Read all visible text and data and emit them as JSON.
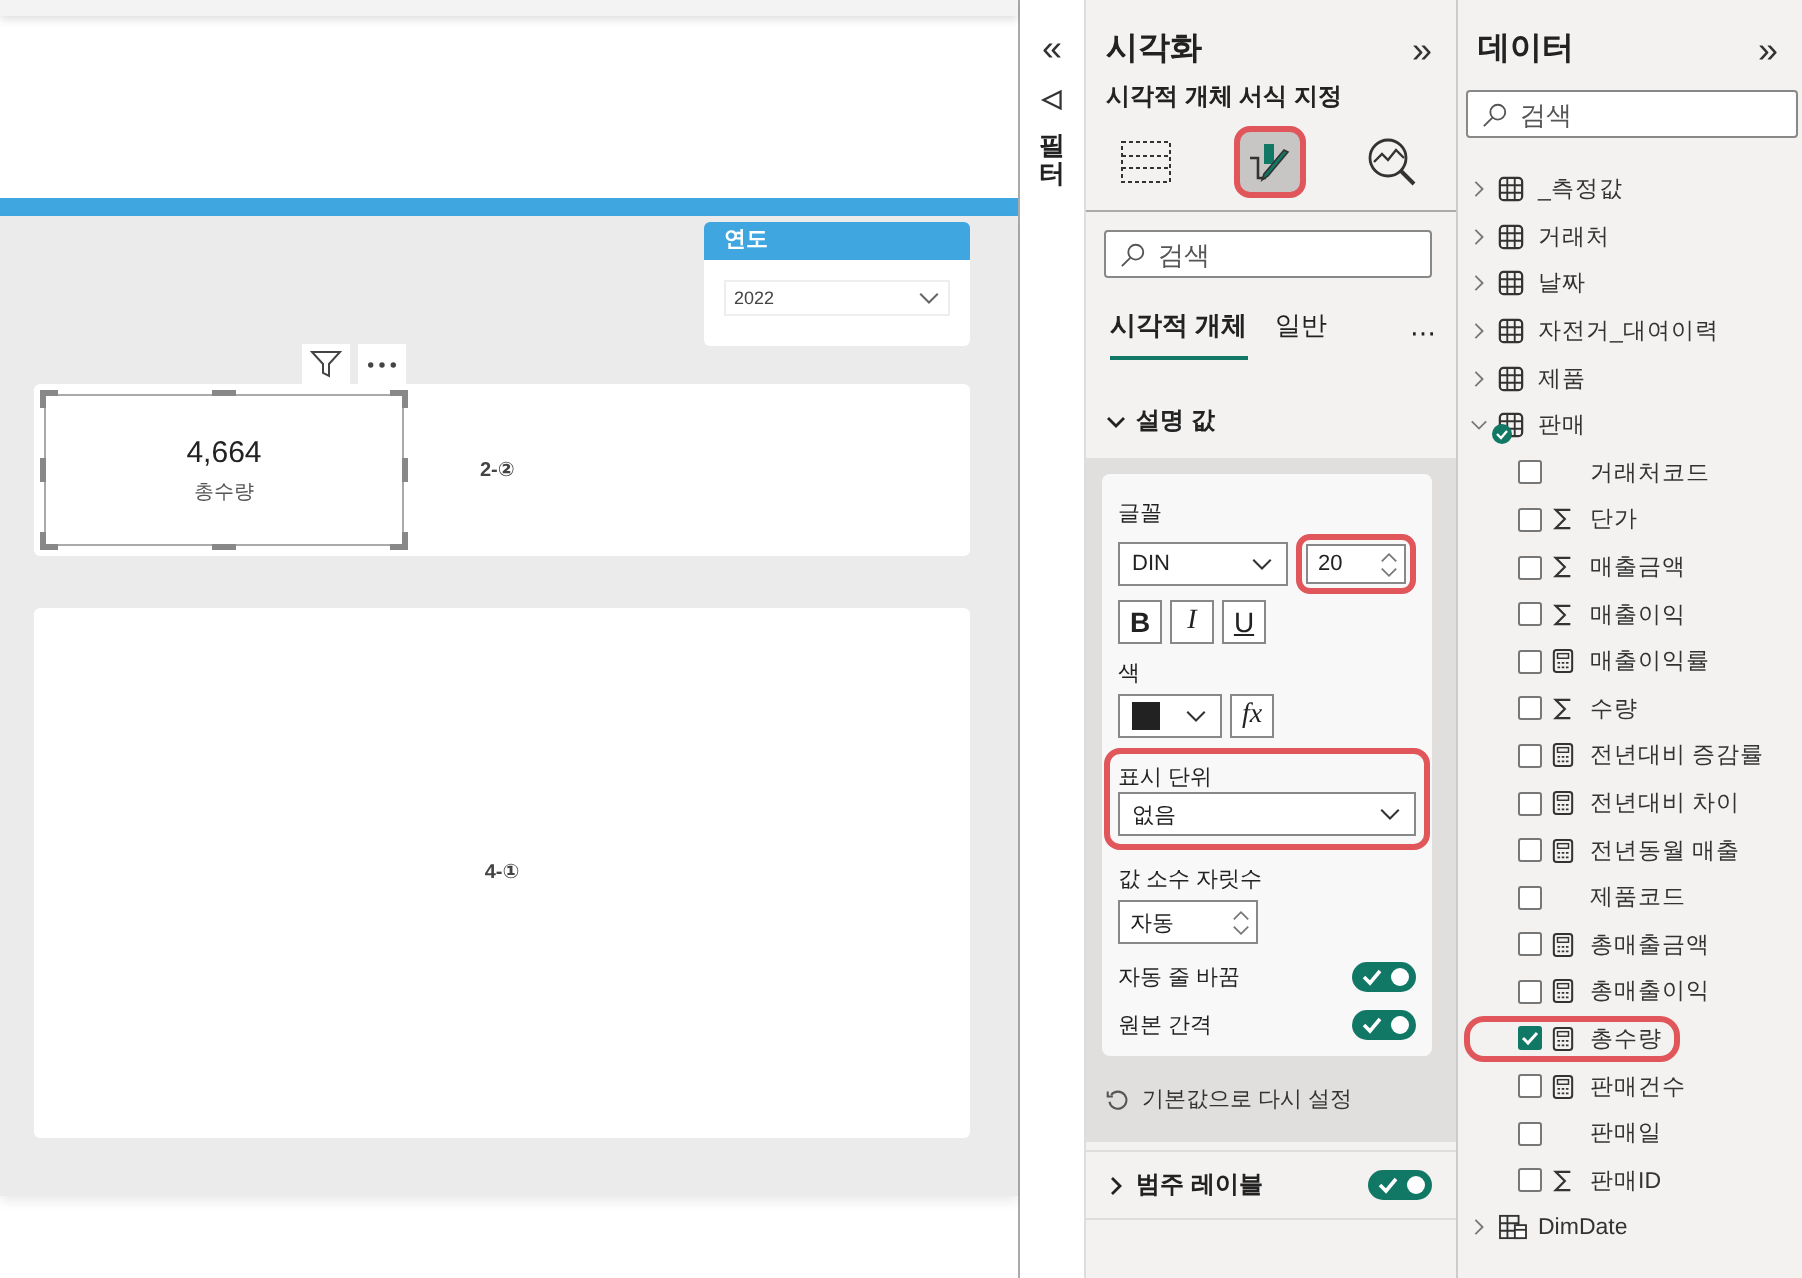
{
  "canvas": {
    "slicer": {
      "title": "연도",
      "value": "2022"
    },
    "kpi": {
      "value": "4,664",
      "label": "총수량",
      "selected": true
    },
    "placeholders": [
      {
        "text": "2-②"
      },
      {
        "text": "4-①"
      }
    ]
  },
  "filter_strip": {
    "expand": "«",
    "label": "필터"
  },
  "visualizations": {
    "title": "시각화",
    "collapse": "»",
    "subtitle": "시각적 개체 서식 지정",
    "view_buttons": [
      {
        "kind": "build",
        "selected": false,
        "highlighted": false
      },
      {
        "kind": "format",
        "selected": true,
        "highlighted": true
      },
      {
        "kind": "analytics",
        "selected": false,
        "highlighted": false
      }
    ],
    "search": {
      "placeholder": "검색"
    },
    "tabs": [
      {
        "label": "시각적 개체",
        "selected": true
      },
      {
        "label": "일반",
        "selected": false
      }
    ],
    "more": "⋯",
    "section": {
      "title": "설명 값",
      "expanded": true
    },
    "font": {
      "label": "글꼴",
      "family": "DIN",
      "size": "20",
      "size_highlighted": true,
      "bold_label": "B",
      "italic_label": "I",
      "underline_label": "U"
    },
    "color": {
      "label": "색",
      "fx_label": "fx"
    },
    "display_units": {
      "label": "표시 단위",
      "value": "없음",
      "highlighted": true
    },
    "decimals": {
      "label": "값 소수 자릿수",
      "value": "자동"
    },
    "toggles": [
      {
        "label": "자동 줄 바꿈",
        "on": true
      },
      {
        "label": "원본 간격",
        "on": true
      }
    ],
    "reset": "기본값으로 다시 설정",
    "next_section": {
      "title": "범주 레이블",
      "expanded": false,
      "on": true
    }
  },
  "data": {
    "title": "데이터",
    "collapse": "»",
    "search": {
      "placeholder": "검색"
    },
    "tables": [
      {
        "name": "_측정값",
        "kind": "table",
        "expanded": false,
        "in_use": false
      },
      {
        "name": "거래처",
        "kind": "table",
        "expanded": false,
        "in_use": false
      },
      {
        "name": "날짜",
        "kind": "table",
        "expanded": false,
        "in_use": false
      },
      {
        "name": "자전거_대여이력",
        "kind": "table",
        "expanded": false,
        "in_use": false
      },
      {
        "name": "제품",
        "kind": "table",
        "expanded": false,
        "in_use": false
      },
      {
        "name": "판매",
        "kind": "table",
        "expanded": true,
        "in_use": true,
        "fields": [
          {
            "name": "거래처코드",
            "kind": "column",
            "checked": false,
            "highlighted": false
          },
          {
            "name": "단가",
            "kind": "sum",
            "checked": false,
            "highlighted": false
          },
          {
            "name": "매출금액",
            "kind": "sum",
            "checked": false,
            "highlighted": false
          },
          {
            "name": "매출이익",
            "kind": "sum",
            "checked": false,
            "highlighted": false
          },
          {
            "name": "매출이익률",
            "kind": "measure",
            "checked": false,
            "highlighted": false
          },
          {
            "name": "수량",
            "kind": "sum",
            "checked": false,
            "highlighted": false
          },
          {
            "name": "전년대비 증감률",
            "kind": "measure",
            "checked": false,
            "highlighted": false
          },
          {
            "name": "전년대비 차이",
            "kind": "measure",
            "checked": false,
            "highlighted": false
          },
          {
            "name": "전년동월 매출",
            "kind": "measure",
            "checked": false,
            "highlighted": false
          },
          {
            "name": "제품코드",
            "kind": "column",
            "checked": false,
            "highlighted": false
          },
          {
            "name": "총매출금액",
            "kind": "measure",
            "checked": false,
            "highlighted": false
          },
          {
            "name": "총매출이익",
            "kind": "measure",
            "checked": false,
            "highlighted": false
          },
          {
            "name": "총수량",
            "kind": "measure",
            "checked": true,
            "highlighted": true
          },
          {
            "name": "판매건수",
            "kind": "measure",
            "checked": false,
            "highlighted": false
          },
          {
            "name": "판매일",
            "kind": "column",
            "checked": false,
            "highlighted": false
          },
          {
            "name": "판매ID",
            "kind": "sum",
            "checked": false,
            "highlighted": false
          }
        ]
      },
      {
        "name": "DimDate",
        "kind": "date_table",
        "expanded": false,
        "in_use": false
      }
    ]
  }
}
